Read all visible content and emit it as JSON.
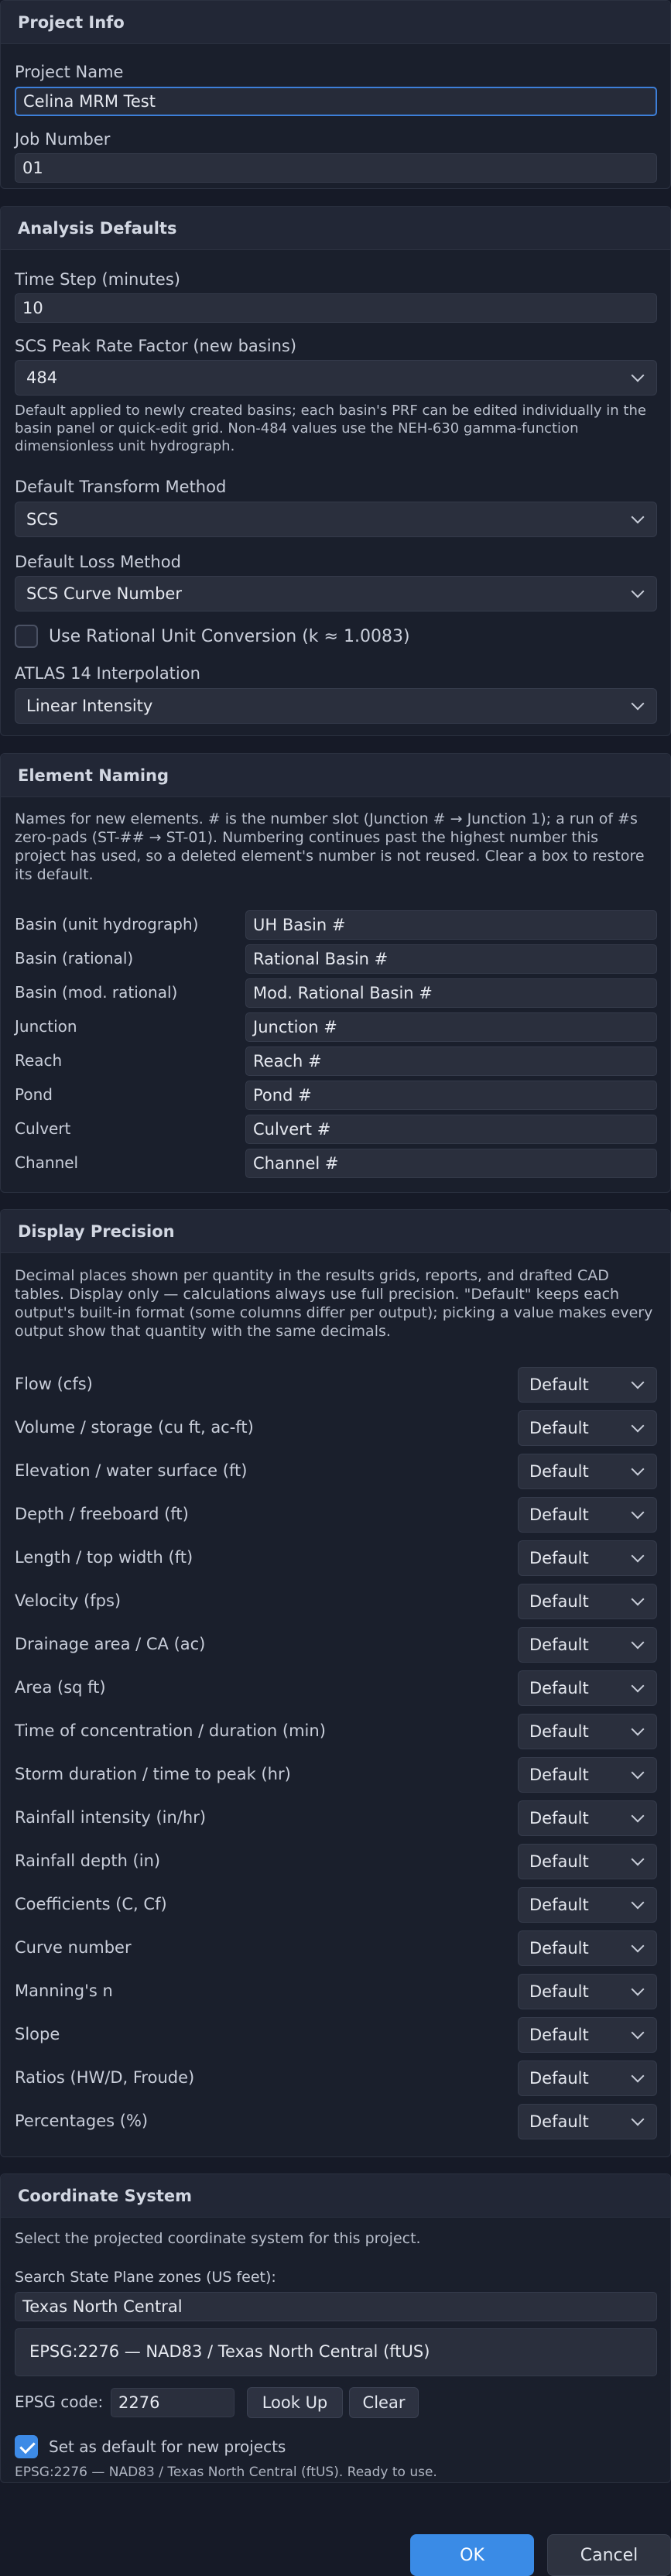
{
  "project_info": {
    "header": "Project Info",
    "project_name_label": "Project Name",
    "project_name_value": "Celina MRM Test",
    "job_number_label": "Job Number",
    "job_number_value": "01"
  },
  "analysis_defaults": {
    "header": "Analysis Defaults",
    "time_step_label": "Time Step (minutes)",
    "time_step_value": "10",
    "prf_label": "SCS Peak Rate Factor (new basins)",
    "prf_value": "484",
    "prf_description": "Default applied to newly created basins; each basin's PRF can be edited individually in the basin panel or quick-edit grid. Non-484 values use the NEH-630 gamma-function dimensionless unit hydrograph.",
    "transform_label": "Default Transform Method",
    "transform_value": "SCS",
    "loss_label": "Default Loss Method",
    "loss_value": "SCS Curve Number",
    "rational_checkbox_label": "Use Rational Unit Conversion (k ≈ 1.0083)",
    "rational_checked": false,
    "atlas_label": "ATLAS 14 Interpolation",
    "atlas_value": "Linear Intensity"
  },
  "element_naming": {
    "header": "Element Naming",
    "description": "Names for new elements. # is the number slot (Junction # → Junction 1); a run of #s zero-pads (ST-## → ST-01). Numbering continues past the highest number this project has used, so a deleted element's number is not reused. Clear a box to restore its default.",
    "rows": [
      {
        "label": "Basin (unit hydrograph)",
        "value": "UH Basin #"
      },
      {
        "label": "Basin (rational)",
        "value": "Rational Basin #"
      },
      {
        "label": "Basin (mod. rational)",
        "value": "Mod. Rational Basin #"
      },
      {
        "label": "Junction",
        "value": "Junction #"
      },
      {
        "label": "Reach",
        "value": "Reach #"
      },
      {
        "label": "Pond",
        "value": "Pond #"
      },
      {
        "label": "Culvert",
        "value": "Culvert #"
      },
      {
        "label": "Channel",
        "value": "Channel #"
      }
    ]
  },
  "display_precision": {
    "header": "Display Precision",
    "description": "Decimal places shown per quantity in the results grids, reports, and drafted CAD tables. Display only — calculations always use full precision. \"Default\" keeps each output's built-in format (some columns differ per output); picking a value makes every output show that quantity with the same decimals.",
    "rows": [
      {
        "label": "Flow (cfs)",
        "value": "Default"
      },
      {
        "label": "Volume / storage (cu ft, ac-ft)",
        "value": "Default"
      },
      {
        "label": "Elevation / water surface (ft)",
        "value": "Default"
      },
      {
        "label": "Depth / freeboard (ft)",
        "value": "Default"
      },
      {
        "label": "Length / top width (ft)",
        "value": "Default"
      },
      {
        "label": "Velocity (fps)",
        "value": "Default"
      },
      {
        "label": "Drainage area / CA (ac)",
        "value": "Default"
      },
      {
        "label": "Area (sq ft)",
        "value": "Default"
      },
      {
        "label": "Time of concentration / duration (min)",
        "value": "Default"
      },
      {
        "label": "Storm duration / time to peak (hr)",
        "value": "Default"
      },
      {
        "label": "Rainfall intensity (in/hr)",
        "value": "Default"
      },
      {
        "label": "Rainfall depth (in)",
        "value": "Default"
      },
      {
        "label": "Coefficients (C, Cf)",
        "value": "Default"
      },
      {
        "label": "Curve number",
        "value": "Default"
      },
      {
        "label": "Manning's n",
        "value": "Default"
      },
      {
        "label": "Slope",
        "value": "Default"
      },
      {
        "label": "Ratios (HW/D, Froude)",
        "value": "Default"
      },
      {
        "label": "Percentages (%)",
        "value": "Default"
      }
    ]
  },
  "coordinate_system": {
    "header": "Coordinate System",
    "description": "Select the projected coordinate system for this project.",
    "search_label": "Search State Plane zones (US feet):",
    "search_value": "Texas North Central",
    "result_item": "EPSG:2276 — NAD83 / Texas North Central (ftUS)",
    "epsg_label": "EPSG code:",
    "epsg_value": "2276",
    "lookup_label": "Look Up",
    "clear_label": "Clear",
    "default_checkbox_label": "Set as default for new projects",
    "default_checked": true,
    "status_text": "EPSG:2276 — NAD83 / Texas North Central (ftUS). Ready to use."
  },
  "footer": {
    "ok_label": "OK",
    "cancel_label": "Cancel"
  },
  "colors": {
    "background": "#161a27",
    "panel": "#1a1f2c",
    "accent": "#3a8be6",
    "focus_border": "#3d7fd9"
  }
}
